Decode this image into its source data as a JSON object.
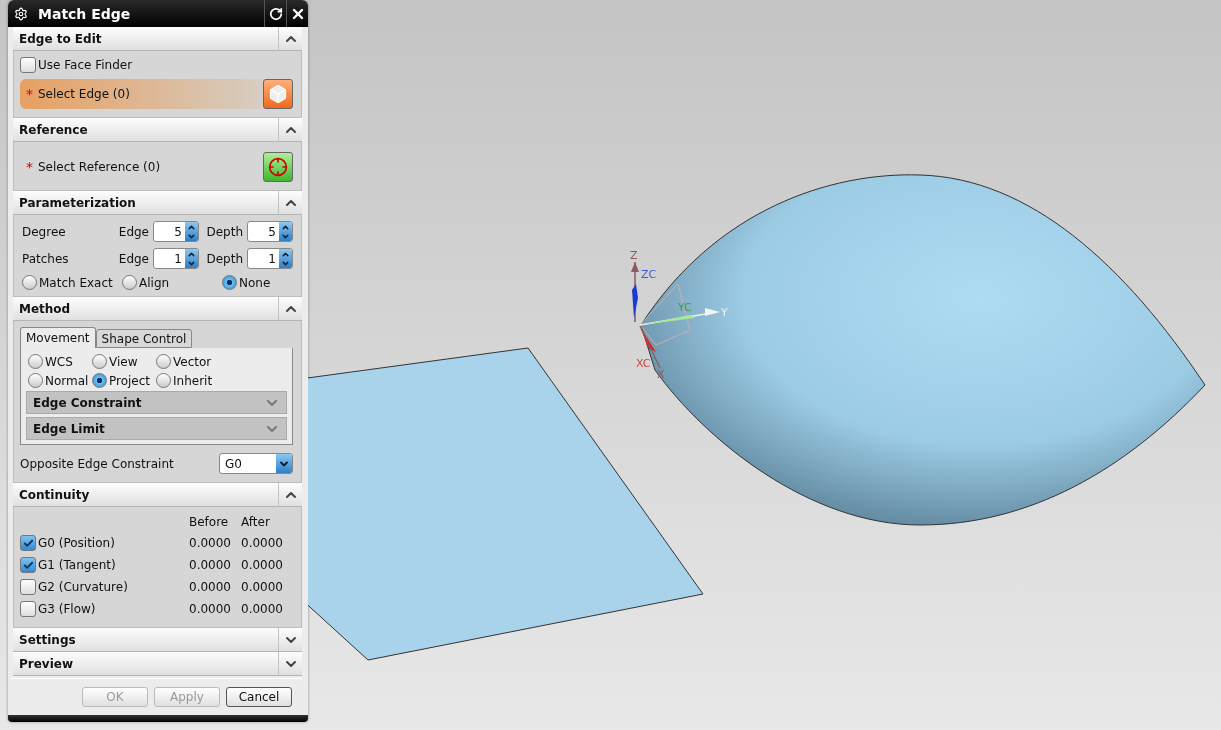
{
  "dialog": {
    "title": "Match Edge"
  },
  "sections": [
    {
      "kind": "edge_to_edit",
      "title": "Edge to Edit",
      "expanded": true,
      "checkbox": {
        "label": "Use Face Finder",
        "checked": false
      },
      "select": {
        "mark": "*",
        "label": "Select Edge (0)",
        "active": true
      }
    },
    {
      "kind": "reference",
      "title": "Reference",
      "expanded": true,
      "select": {
        "mark": "*",
        "label": "Select Reference (0)",
        "active": false
      }
    },
    {
      "kind": "parameterization",
      "title": "Parameterization",
      "expanded": true,
      "rows": [
        {
          "label": "Degree",
          "fields": [
            {
              "label": "Edge",
              "value": "5"
            },
            {
              "label": "Depth",
              "value": "5"
            }
          ]
        },
        {
          "label": "Patches",
          "fields": [
            {
              "label": "Edge",
              "value": "1"
            },
            {
              "label": "Depth",
              "value": "1"
            }
          ]
        }
      ],
      "options": [
        {
          "label": "Match Exact",
          "selected": false
        },
        {
          "label": "Align",
          "selected": false
        },
        {
          "label": "None",
          "selected": true
        }
      ]
    },
    {
      "kind": "method",
      "title": "Method",
      "expanded": true,
      "tabs": [
        {
          "label": "Movement",
          "selected": true
        },
        {
          "label": "Shape Control",
          "selected": false
        }
      ],
      "options": [
        {
          "label": "WCS",
          "selected": false
        },
        {
          "label": "View",
          "selected": false
        },
        {
          "label": "Vector",
          "selected": false
        },
        {
          "label": "Normal",
          "selected": false
        },
        {
          "label": "Project",
          "selected": true
        },
        {
          "label": "Inherit",
          "selected": false
        }
      ],
      "groups": [
        {
          "title": "Edge Constraint",
          "expanded": false
        },
        {
          "title": "Edge Limit",
          "expanded": false
        }
      ],
      "dropdown": {
        "label": "Opposite Edge Constraint",
        "value": "G0"
      }
    },
    {
      "kind": "continuity",
      "title": "Continuity",
      "expanded": true,
      "columns": [
        "Before",
        "After"
      ],
      "rows": [
        {
          "label": "G0 (Position)",
          "checked": true,
          "before": "0.0000",
          "after": "0.0000"
        },
        {
          "label": "G1 (Tangent)",
          "checked": true,
          "before": "0.0000",
          "after": "0.0000"
        },
        {
          "label": "G2 (Curvature)",
          "checked": false,
          "before": "0.0000",
          "after": "0.0000"
        },
        {
          "label": "G3 (Flow)",
          "checked": false,
          "before": "0.0000",
          "after": "0.0000"
        }
      ]
    },
    {
      "title": "Settings",
      "expanded": false
    },
    {
      "title": "Preview",
      "expanded": false
    }
  ],
  "buttons": [
    {
      "label": "OK",
      "disabled": true
    },
    {
      "label": "Apply",
      "disabled": true
    },
    {
      "label": "Cancel",
      "disabled": false
    }
  ],
  "viewport": {
    "triad_labels": [
      {
        "text": "Z",
        "color": "#8a5a5a"
      },
      {
        "text": "ZC",
        "color": "#3b5bd6"
      },
      {
        "text": "YC",
        "color": "#3f9a3f"
      },
      {
        "text": "Y",
        "color": "#f4f4f4"
      },
      {
        "text": "XC",
        "color": "#d04040"
      },
      {
        "text": "X",
        "color": "#8a5a5a"
      }
    ]
  }
}
